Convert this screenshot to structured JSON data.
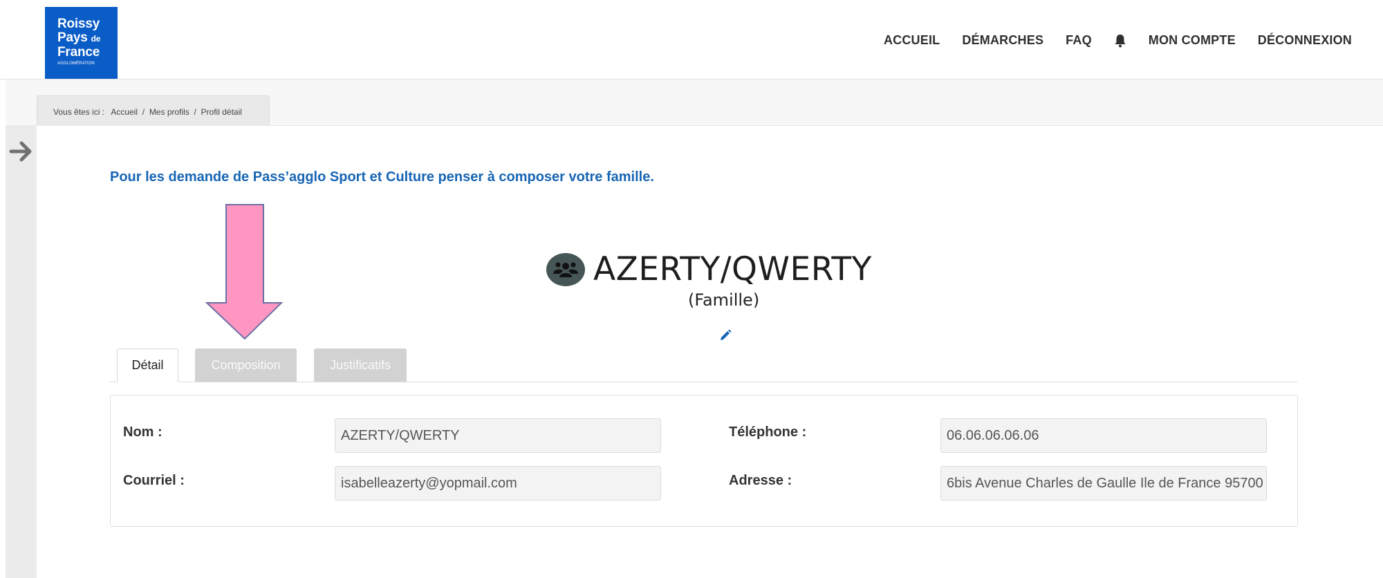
{
  "header": {
    "logo": {
      "line1": "Roissy",
      "line2": "Pays",
      "line2_small": "de",
      "line3": "France",
      "line4": "AGGLOMÉRATION"
    },
    "nav": [
      {
        "label": "ACCUEIL"
      },
      {
        "label": "DÉMARCHES"
      },
      {
        "label": "FAQ"
      },
      {
        "icon": "bell-icon"
      },
      {
        "label": "MON COMPTE"
      },
      {
        "label": "DÉCONNEXION"
      }
    ]
  },
  "breadcrumb": {
    "prefix": "Vous êtes ici :",
    "items": [
      "Accueil",
      "Mes profils",
      "Profil détail"
    ],
    "separator": "/"
  },
  "notice": "Pour les demande de Pass’agglo Sport et Culture penser à composer votre famille.",
  "profile": {
    "name": "AZERTY/QWERTY",
    "type": "(Famille)",
    "icon": "family-icon"
  },
  "tabs": [
    {
      "label": "Détail",
      "active": true
    },
    {
      "label": "Composition",
      "active": false
    },
    {
      "label": "Justificatifs",
      "active": false
    }
  ],
  "detail": {
    "nom_label": "Nom :",
    "nom_value": "AZERTY/QWERTY",
    "courriel_label": "Courriel :",
    "courriel_value": "isabelleazerty@yopmail.com",
    "telephone_label": "Téléphone :",
    "telephone_value": "06.06.06.06.06",
    "adresse_label": "Adresse :",
    "adresse_value": "6bis Avenue Charles de Gaulle Ile de France 95700"
  },
  "colors": {
    "brand_blue": "#0a5cc7",
    "notice_blue": "#1765b5",
    "pink_arrow": "#ff96c2"
  }
}
